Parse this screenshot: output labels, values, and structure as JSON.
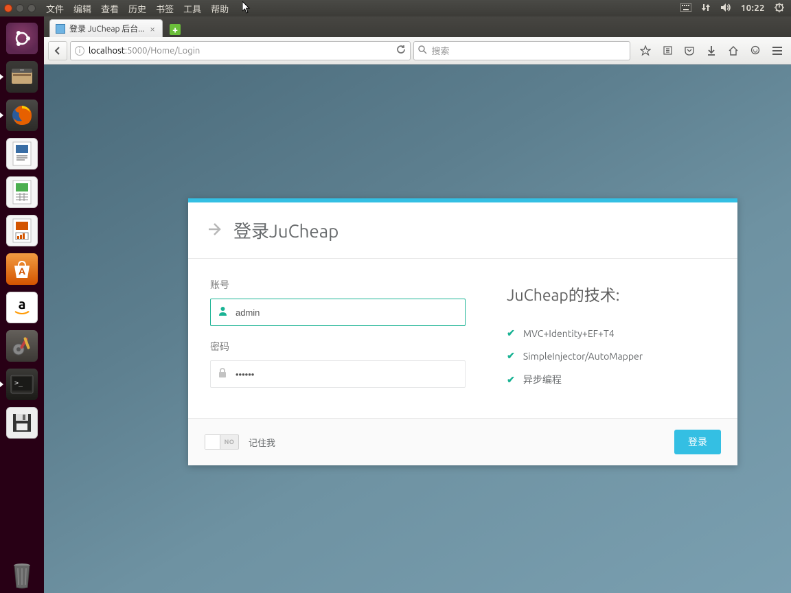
{
  "menubar": {
    "items": [
      "文件",
      "编辑",
      "查看",
      "历史",
      "书签",
      "工具",
      "帮助"
    ],
    "clock": "10:22"
  },
  "browser": {
    "tab_title": "登录 JuCheap 后台...",
    "url_host_bold": "localhost",
    "url_rest": ":5000/Home/Login",
    "search_placeholder": "搜索"
  },
  "login": {
    "heading": "登录JuCheap",
    "username_label": "账号",
    "username_value": "admin",
    "password_label": "密码",
    "password_value": "••••••",
    "tech_heading": "JuCheap的技术:",
    "tech_items": [
      "MVC+Identity+EF+T4",
      "SimpleInjector/AutoMapper",
      "异步编程"
    ],
    "toggle_text": "NO",
    "remember_label": "记住我",
    "submit_label": "登录"
  }
}
